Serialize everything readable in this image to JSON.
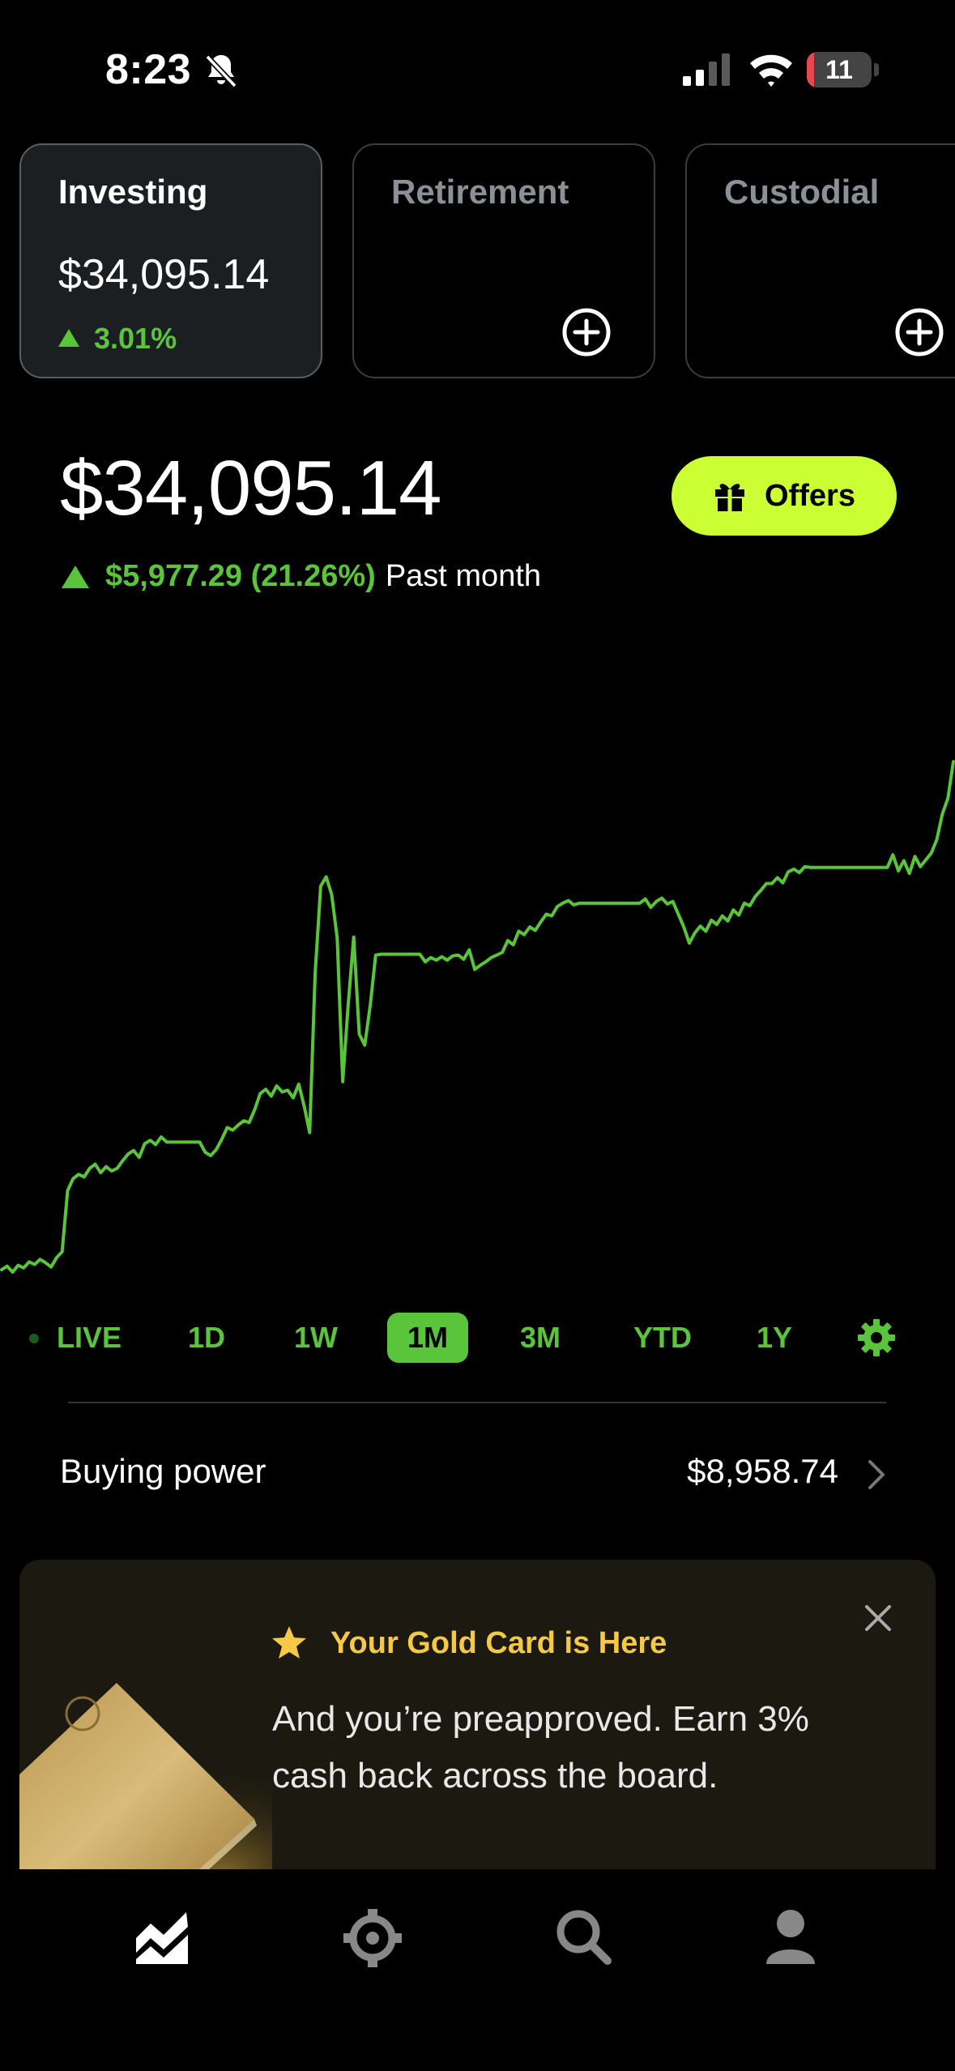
{
  "status_bar": {
    "time": "8:23",
    "battery": "11",
    "battery_level": 0.11,
    "icons": [
      "bell-slash-icon",
      "cellular-signal-icon",
      "wifi-icon",
      "battery-icon"
    ]
  },
  "accounts": [
    {
      "title": "Investing",
      "value": "$34,095.14",
      "change": "3.01%",
      "active": true
    },
    {
      "title": "Retirement",
      "value": "",
      "change": "",
      "active": false,
      "icon": "plus-circle-icon"
    },
    {
      "title": "Custodial",
      "value": "",
      "change": "",
      "active": false,
      "icon": "plus-circle-icon"
    }
  ],
  "portfolio": {
    "value": "$34,095.14",
    "change": "$5,977.29 (21.26%)",
    "period": "Past month"
  },
  "offers_button": {
    "label": "Offers",
    "icon": "gift-icon",
    "color": "#ccff33"
  },
  "chart_data": {
    "type": "line",
    "title": "",
    "xlabel": "",
    "ylabel": "",
    "grid": false,
    "color": "#5ac53b",
    "series": [
      {
        "values": [
          28118,
          28160,
          28090,
          28170,
          28140,
          28210,
          28180,
          28240,
          28200,
          28150,
          28260,
          28330,
          29050,
          29190,
          29240,
          29210,
          29310,
          29360,
          29260,
          29330,
          29280,
          29310,
          29400,
          29480,
          29520,
          29440,
          29600,
          29640,
          29590,
          29680,
          29620,
          29620,
          29620,
          29620,
          29620,
          29620,
          29620,
          29500,
          29460,
          29530,
          29650,
          29790,
          29760,
          29820,
          29870,
          29850,
          30000,
          30190,
          30240,
          30160,
          30280,
          30210,
          30230,
          30140,
          30300,
          30040,
          29730,
          31610,
          32630,
          32740,
          32530,
          32020,
          30330,
          31240,
          32030,
          30890,
          30760,
          31230,
          31820,
          31830,
          31830,
          31830,
          31830,
          31830,
          31830,
          31830,
          31830,
          31740,
          31790,
          31760,
          31800,
          31760,
          31810,
          31820,
          31770,
          31880,
          31650,
          31700,
          31740,
          31790,
          31820,
          31850,
          31990,
          31940,
          32100,
          32060,
          32150,
          32110,
          32210,
          32300,
          32280,
          32390,
          32430,
          32460,
          32410,
          32430,
          32430,
          32430,
          32430,
          32430,
          32430,
          32430,
          32430,
          32430,
          32430,
          32430,
          32430,
          32480,
          32380,
          32450,
          32490,
          32420,
          32450,
          32300,
          32150,
          31960,
          32080,
          32160,
          32100,
          32230,
          32180,
          32280,
          32220,
          32350,
          32290,
          32430,
          32400,
          32510,
          32580,
          32660,
          32660,
          32730,
          32670,
          32800,
          32830,
          32790,
          32860,
          32850,
          32850,
          32850,
          32850,
          32850,
          32850,
          32850,
          32850,
          32850,
          32850,
          32850,
          32850,
          32850,
          32850,
          32850,
          33000,
          32810,
          32930,
          32780,
          32980,
          32860,
          32940,
          33020,
          33180,
          33480,
          33660,
          34095
        ]
      }
    ]
  },
  "time_ranges": {
    "items": [
      "LIVE",
      "1D",
      "1W",
      "1M",
      "3M",
      "YTD",
      "1Y"
    ],
    "active": "1M",
    "settings_icon": "gear-icon"
  },
  "buying_power": {
    "label": "Buying power",
    "value": "$8,958.74"
  },
  "promo": {
    "title": "Your Gold Card is Here",
    "body": "And you’re preapproved. Earn 3% cash back across the board.",
    "star_icon": "star-icon",
    "close_icon": "close-icon"
  },
  "bottom_nav": {
    "items": [
      "portfolio-chart-icon",
      "crypto-icon",
      "search-icon",
      "account-icon"
    ],
    "active": "portfolio-chart-icon"
  },
  "colors": {
    "accent_green": "#5ac53b",
    "offers_lime": "#ccff33",
    "gold": "#f5c845",
    "background": "#000000"
  }
}
